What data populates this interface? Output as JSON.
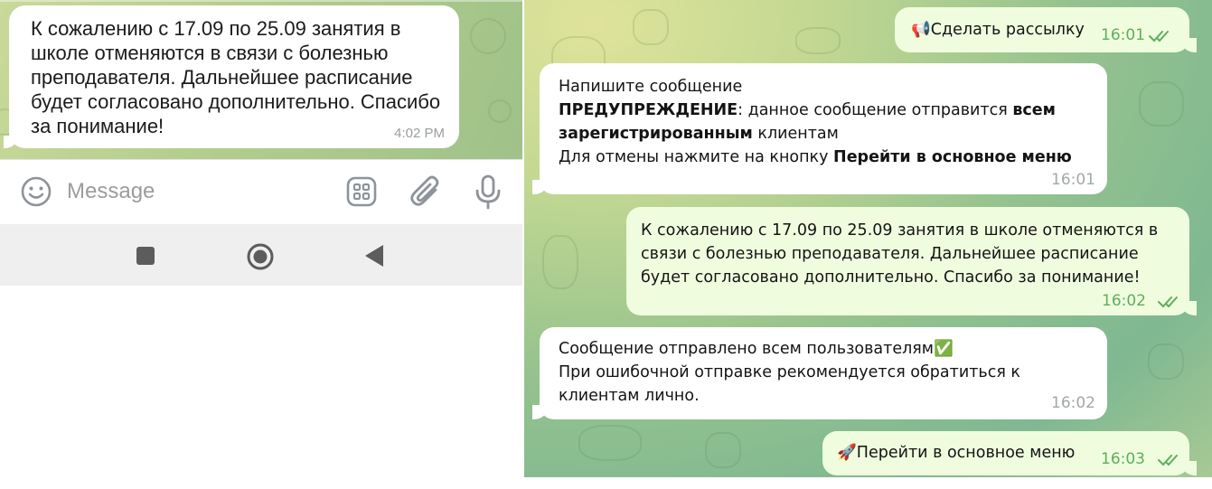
{
  "mobile": {
    "message": {
      "text": "К сожалению с 17.09 по 25.09 занятия в школе отменяются в связи с болезнью преподавателя. Дальнейшее расписание будет согласовано дополнительно. Спасибо за понимание!",
      "time": "4:02 PM"
    },
    "composer": {
      "placeholder": "Message",
      "icons": [
        "emoji-icon",
        "stickers-icon",
        "paperclip-icon",
        "microphone-icon"
      ]
    },
    "navbar": {
      "icons": [
        "recent-apps-icon",
        "home-icon",
        "back-icon"
      ]
    }
  },
  "desktop": {
    "colors": {
      "outgoing_bubble": "#effdde",
      "incoming_bubble": "#ffffff",
      "outgoing_time": "#5fae5c"
    },
    "messages": [
      {
        "direction": "out",
        "emoji": "📢",
        "text": "Сделать рассылку",
        "time": "16:01",
        "status": "read"
      },
      {
        "direction": "in",
        "line1": "Напишите сообщение",
        "warn_label": "ПРЕДУПРЕЖДЕНИЕ",
        "warn_text": ": данное сообщение отправится ",
        "warn_bold1": "всем",
        "warn_bold2": "зарегистрированным",
        "warn_tail": " клиентам",
        "cancel_text": "Для отмены нажмите на кнопку ",
        "cancel_bold": "Перейти в основное меню",
        "time": "16:01"
      },
      {
        "direction": "out",
        "line1": "К сожалению с 17.09 по 25.09 занятия в школе отменяются в",
        "line2": "связи с болезнью преподавателя. Дальнейшее расписание",
        "line3": "будет согласовано дополнительно. Спасибо за понимание!",
        "time": "16:02",
        "status": "read"
      },
      {
        "direction": "in",
        "line1": "Сообщение отправлено всем пользователям",
        "emoji": "✅",
        "line2": "При ошибочной отправке рекомендуется обратиться к",
        "line3": "клиентам лично.",
        "time": "16:02"
      },
      {
        "direction": "out",
        "emoji": "🚀",
        "text": "Перейти в основное меню",
        "time": "16:03",
        "status": "read"
      }
    ]
  }
}
